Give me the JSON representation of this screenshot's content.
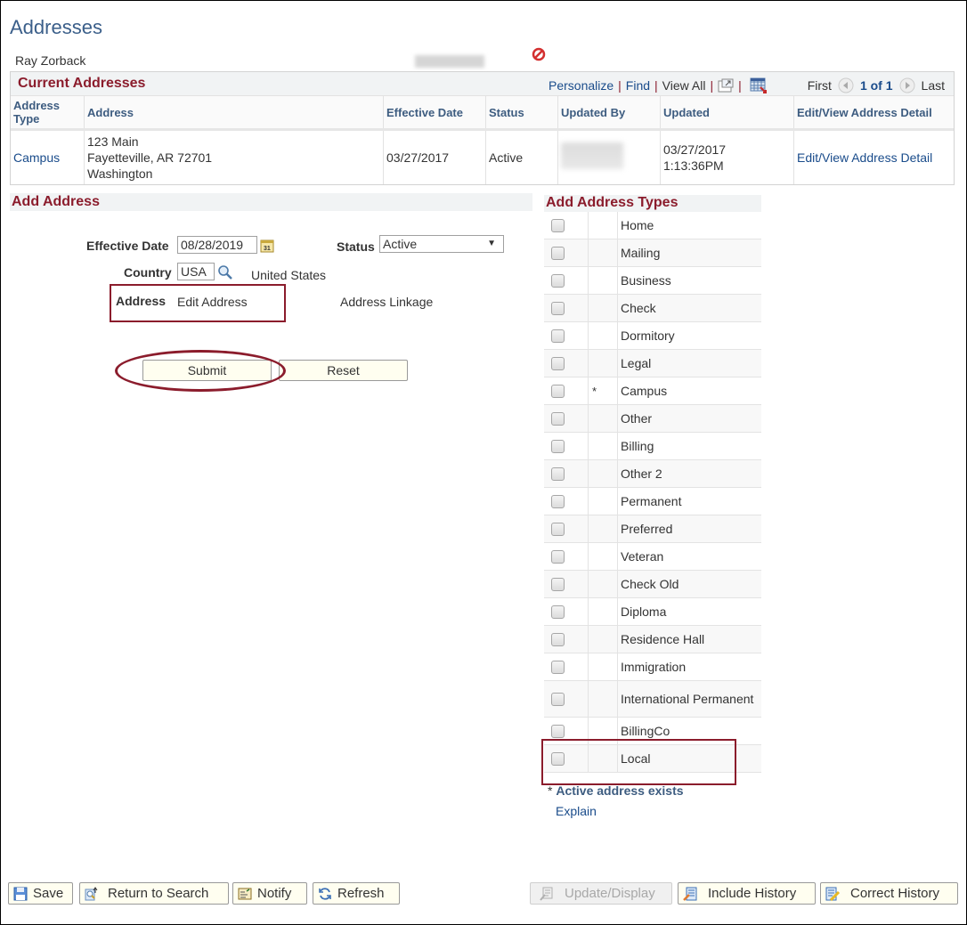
{
  "page": {
    "title": "Addresses",
    "person_name": "Ray Zorback"
  },
  "current_addresses": {
    "title": "Current Addresses",
    "nav": {
      "personalize": "Personalize",
      "find": "Find",
      "view_all": "View All",
      "first": "First",
      "page_count": "1 of 1",
      "last": "Last"
    },
    "columns": [
      "Address Type",
      "Address",
      "Effective Date",
      "Status",
      "Updated By",
      "Updated",
      "Edit/View Address Detail"
    ],
    "rows": [
      {
        "address_type": "Campus",
        "address_line1": "123 Main",
        "address_line2": "Fayetteville, AR 72701",
        "address_line3": "Washington",
        "effective_date": "03/27/2017",
        "status": "Active",
        "updated_date": "03/27/2017",
        "updated_time": "1:13:36PM",
        "detail_link": "Edit/View Address Detail"
      }
    ]
  },
  "add_address": {
    "title": "Add Address",
    "effective_date_label": "Effective Date",
    "effective_date_value": "08/28/2019",
    "status_label": "Status",
    "status_value": "Active",
    "country_label": "Country",
    "country_value": "USA",
    "country_description": "United States",
    "address_label": "Address",
    "edit_address_link": "Edit Address",
    "address_linkage_link": "Address Linkage",
    "submit_label": "Submit",
    "reset_label": "Reset"
  },
  "address_types": {
    "title": "Add Address Types",
    "items": [
      {
        "name": "Home",
        "marker": ""
      },
      {
        "name": "Mailing",
        "marker": ""
      },
      {
        "name": "Business",
        "marker": ""
      },
      {
        "name": "Check",
        "marker": ""
      },
      {
        "name": "Dormitory",
        "marker": ""
      },
      {
        "name": "Legal",
        "marker": ""
      },
      {
        "name": "Campus",
        "marker": "*"
      },
      {
        "name": "Other",
        "marker": ""
      },
      {
        "name": "Billing",
        "marker": ""
      },
      {
        "name": "Other 2",
        "marker": ""
      },
      {
        "name": "Permanent",
        "marker": ""
      },
      {
        "name": "Preferred",
        "marker": ""
      },
      {
        "name": "Veteran",
        "marker": ""
      },
      {
        "name": "Check Old",
        "marker": ""
      },
      {
        "name": "Diploma",
        "marker": ""
      },
      {
        "name": "Residence Hall",
        "marker": ""
      },
      {
        "name": "Immigration",
        "marker": ""
      },
      {
        "name": "International Permanent",
        "marker": ""
      },
      {
        "name": "BillingCo",
        "marker": ""
      },
      {
        "name": "Local",
        "marker": ""
      }
    ],
    "legend_star": "*",
    "legend_text": "Active address exists",
    "explain_link": "Explain"
  },
  "toolbar": {
    "save": "Save",
    "return_to_search": "Return to Search",
    "notify": "Notify",
    "refresh": "Refresh",
    "update_display": "Update/Display",
    "include_history": "Include History",
    "correct_history": "Correct History"
  },
  "colors": {
    "section_title": "#8b1c2c",
    "link": "#1a4c8b",
    "header_text": "#3d5c80",
    "callout": "#8b1c2c"
  }
}
